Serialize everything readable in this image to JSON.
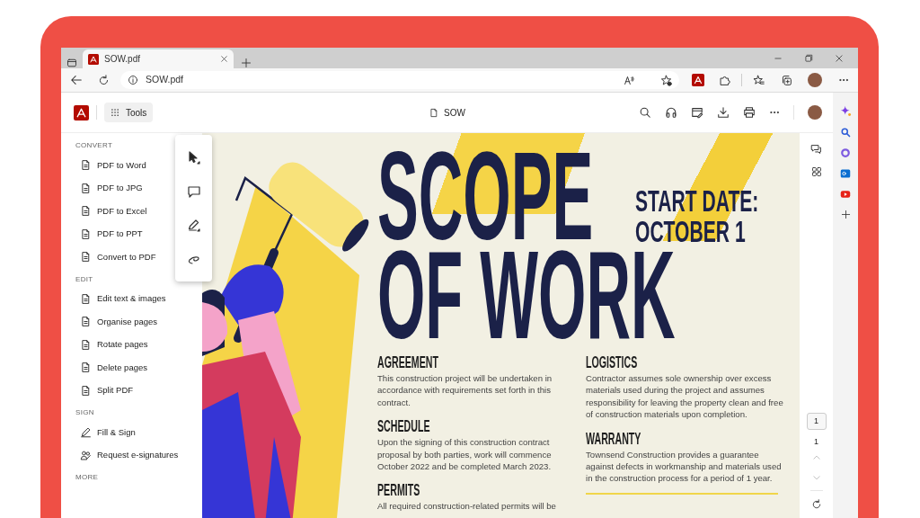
{
  "browser": {
    "tab_title": "SOW.pdf",
    "address": "SOW.pdf"
  },
  "app": {
    "tools_button": "Tools",
    "document_name": "SOW"
  },
  "sidebar": [
    {
      "heading": "CONVERT",
      "items": [
        "PDF to Word",
        "PDF to JPG",
        "PDF to Excel",
        "PDF to PPT",
        "Convert to PDF"
      ]
    },
    {
      "heading": "EDIT",
      "items": [
        "Edit text & images",
        "Organise pages",
        "Rotate pages",
        "Delete pages",
        "Split PDF"
      ]
    },
    {
      "heading": "SIGN",
      "items": [
        "Fill & Sign",
        "Request e-signatures"
      ]
    },
    {
      "heading": "MORE"
    }
  ],
  "document": {
    "title_lines": [
      "SCOPE",
      "OF WORK"
    ],
    "start_date_lines": [
      "START DATE:",
      "OCTOBER 1"
    ],
    "columns": [
      [
        {
          "heading": "AGREEMENT",
          "body": "This construction project will be undertaken in accordance with requirements set forth in this contract."
        },
        {
          "heading": "SCHEDULE",
          "body": "Upon the signing of this construction contract proposal by both parties, work will commence October 2022 and be completed March 2023."
        },
        {
          "heading": "PERMITS",
          "body": "All required construction-related permits will be"
        }
      ],
      [
        {
          "heading": "LOGISTICS",
          "body": "Contractor assumes sole ownership over excess materials used during the project and assumes responsibility for leaving the property clean and free of construction materials upon completion."
        },
        {
          "heading": "WARRANTY",
          "body": "Townsend Construction provides a guarantee against defects in workmanship and materials used in the construction process for a period of 1 year."
        }
      ]
    ]
  },
  "page_nav": {
    "current_page": "1",
    "page_count": "1"
  }
}
